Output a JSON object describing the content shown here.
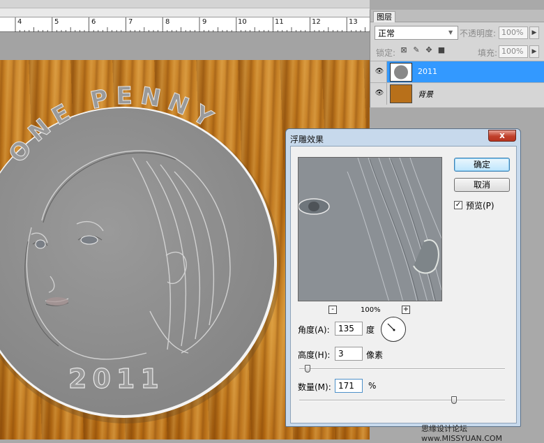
{
  "ruler": {
    "labels": [
      "4",
      "5",
      "6",
      "7",
      "8",
      "9",
      "10",
      "11",
      "12",
      "13"
    ]
  },
  "canvas": {
    "coin_top_text": "ONE PENNY",
    "coin_year": "2011"
  },
  "layers_panel": {
    "tab_label": "图层",
    "blend_mode": "正常",
    "opacity_label": "不透明度:",
    "opacity_value": "100%",
    "lock_label": "锁定:",
    "fill_label": "填充:",
    "fill_value": "100%",
    "layers": [
      {
        "name": "2011",
        "selected": true
      },
      {
        "name": "背景",
        "selected": false
      }
    ]
  },
  "dialog": {
    "title": "浮雕效果",
    "close_label": "x",
    "ok_label": "确定",
    "cancel_label": "取消",
    "preview_label": "预览(P)",
    "preview_checked": true,
    "zoom_minus": "-",
    "zoom_plus": "+",
    "zoom_value": "100%",
    "angle_label": "角度(A):",
    "angle_value": "135",
    "angle_unit": "度",
    "height_label": "高度(H):",
    "height_value": "3",
    "height_unit": "像素",
    "amount_label": "数量(M):",
    "amount_value": "171",
    "amount_unit": "%"
  },
  "watermark": "思缘设计论坛 www.MISSYUAN.COM",
  "colors": {
    "selection_blue": "#3399ff",
    "wood": "#c47d22",
    "coin": "#8e8e8e"
  }
}
